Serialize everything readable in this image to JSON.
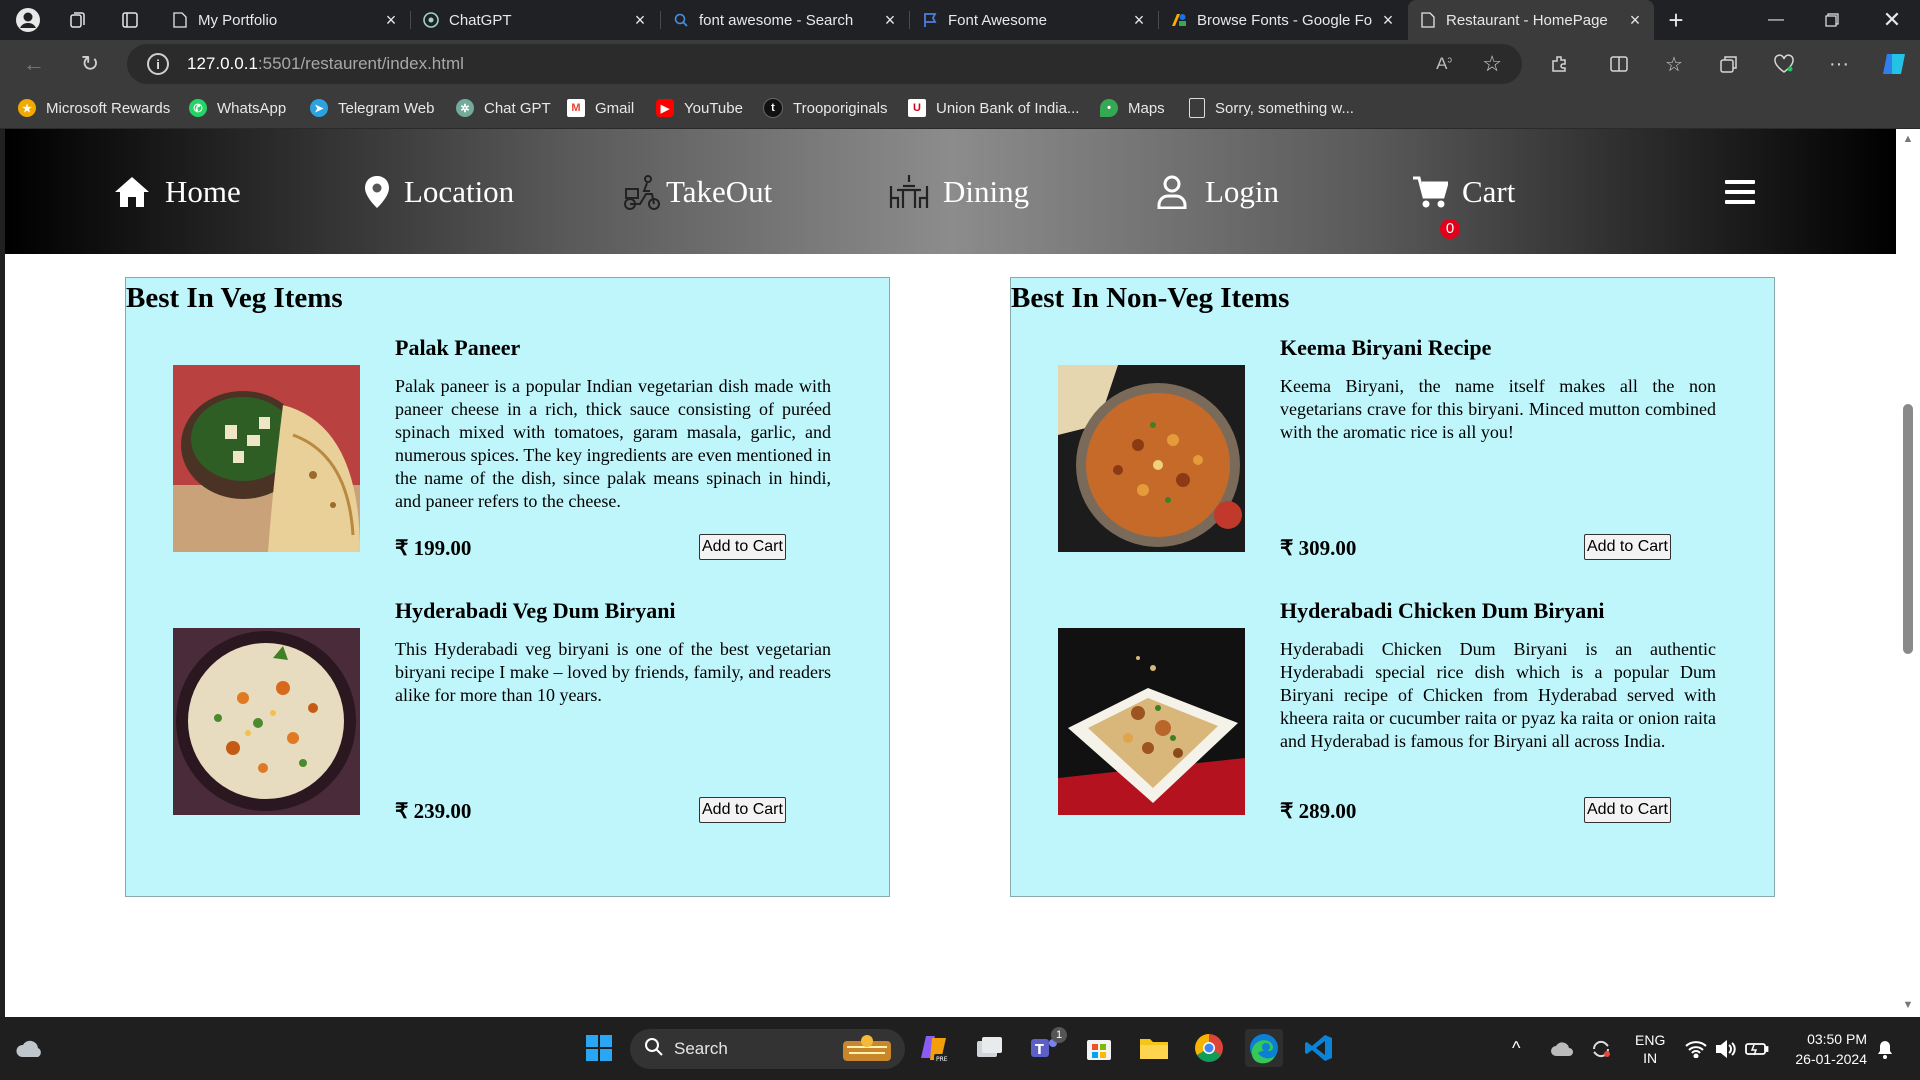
{
  "browser": {
    "tabs": [
      {
        "title": "My Portfolio",
        "icon": "page-icon"
      },
      {
        "title": "ChatGPT",
        "icon": "chatgpt-icon"
      },
      {
        "title": "font awesome - Search",
        "icon": "search-icon"
      },
      {
        "title": "Font Awesome",
        "icon": "flag-icon"
      },
      {
        "title": "Browse Fonts - Google Fo",
        "icon": "google-fonts-icon"
      },
      {
        "title": "Restaurant - HomePage",
        "icon": "page-icon"
      }
    ],
    "url_host": "127.0.0.1",
    "url_path": ":5501/restaurent/index.html",
    "bookmarks": [
      {
        "label": "Microsoft Rewards",
        "color": "#f2a900"
      },
      {
        "label": "WhatsApp",
        "color": "#25d366"
      },
      {
        "label": "Telegram Web",
        "color": "#2aa3e0"
      },
      {
        "label": "Chat GPT",
        "color": "#74aa9c"
      },
      {
        "label": "Gmail",
        "color": "#ea4335"
      },
      {
        "label": "YouTube",
        "color": "#ff0000"
      },
      {
        "label": "Trooporiginals",
        "color": "#111111"
      },
      {
        "label": "Union Bank of India...",
        "color": "#d0021b"
      },
      {
        "label": "Maps",
        "color": "#34a853"
      },
      {
        "label": "Sorry, something w...",
        "color": "#cccccc"
      }
    ]
  },
  "site": {
    "nav": {
      "home": "Home",
      "location": "Location",
      "takeout": "TakeOut",
      "dining": "Dining",
      "login": "Login",
      "cart": "Cart",
      "cart_count": "0"
    },
    "veg": {
      "heading": "Best In Veg Items",
      "items": [
        {
          "name": "Palak Paneer",
          "desc": "Palak paneer is a popular Indian vegetarian dish made with paneer cheese in a rich, thick sauce consisting of puréed spinach mixed with tomatoes, garam masala, garlic, and numerous spices. The key ingredients are even mentioned in the name of the dish, since palak means spinach in hindi, and paneer refers to the cheese.",
          "price": "₹ 199.00",
          "button": "Add to Cart"
        },
        {
          "name": "Hyderabadi Veg Dum Biryani",
          "desc": "This Hyderabadi veg biryani is one of the best vegetarian biryani recipe I make – loved by friends, family, and readers alike for more than 10 years.",
          "price": "₹ 239.00",
          "button": "Add to Cart"
        }
      ]
    },
    "nonveg": {
      "heading": "Best In Non-Veg Items",
      "items": [
        {
          "name": "Keema Biryani Recipe",
          "desc": "Keema Biryani, the name itself makes all the non vegetarians crave for this biryani. Minced mutton combined with the aromatic rice is all you!",
          "price": "₹ 309.00",
          "button": "Add to Cart"
        },
        {
          "name": "Hyderabadi Chicken Dum Biryani",
          "desc": "Hyderabadi Chicken Dum Biryani is an authentic Hyderabadi special rice dish which is a popular Dum Biryani recipe of Chicken from Hyderabad served with kheera raita or cucumber raita or pyaz ka raita or onion raita and Hyderabad is famous for Biryani all across India.",
          "price": "₹ 289.00",
          "button": "Add to Cart"
        }
      ]
    }
  },
  "taskbar": {
    "search": "Search",
    "lang1": "ENG",
    "lang2": "IN",
    "time": "03:50 PM",
    "date": "26-01-2024",
    "teams_badge": "1"
  },
  "colors": {
    "card_bg": "#bff6fb",
    "badge": "#e3001b"
  }
}
